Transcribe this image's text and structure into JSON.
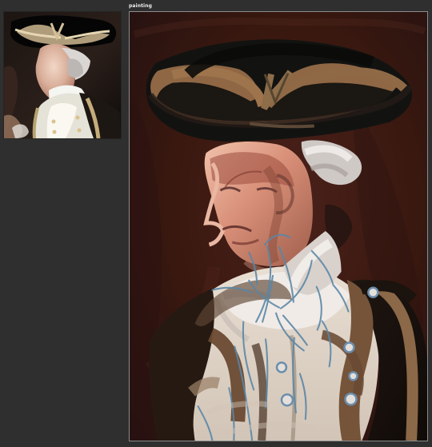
{
  "window": {
    "canvas_title": "painting"
  },
  "colors": {
    "workspace_background": "#2f2f2f",
    "painting_background": "#3a1713",
    "panel_border": "#8b8b8b",
    "title_text": "#f0f0f0"
  },
  "reference": {
    "image_subject": "reference-photo"
  },
  "canvas": {
    "image_subject": "painting-study"
  }
}
